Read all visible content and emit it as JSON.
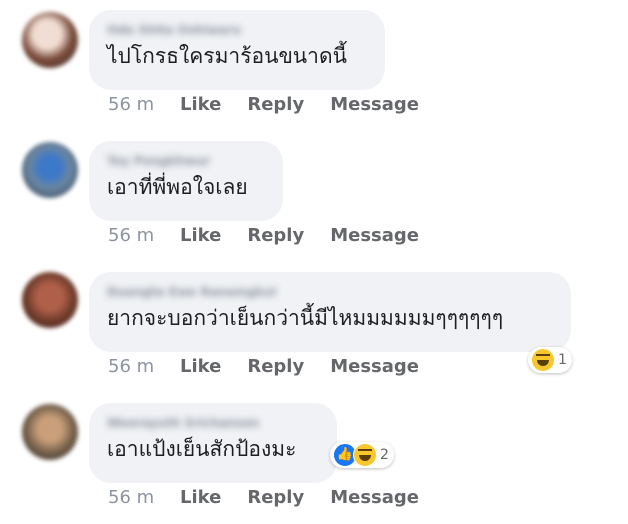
{
  "comments": [
    {
      "author": "Oda Shita Oshiwaru",
      "text": "ไปโกรธใครมาร้อนขนาดนี้",
      "time": "56 m",
      "like": "Like",
      "reply": "Reply",
      "message": "Message",
      "avatar_color": "#c9a89b"
    },
    {
      "author": "Toy Pongkhwur",
      "text": "เอาที่พี่พอใจเลย",
      "time": "56 m",
      "like": "Like",
      "reply": "Reply",
      "message": "Message",
      "avatar_color": "#5a6f86"
    },
    {
      "author": "Duangta Ewe Ranamgkul",
      "text": "ยากจะบอกว่าเย็นกว่านี้มีไหมมมมมมๆๆๆๆๆๆ",
      "time": "56 m",
      "like": "Like",
      "reply": "Reply",
      "message": "Message",
      "reaction_count": "1",
      "reaction_icons": [
        "haha-emoji"
      ],
      "avatar_color": "#8a4b3a"
    },
    {
      "author": "Weerayuth Srichansen",
      "text": "เอาแป้งเย็นสักป้องมะ",
      "time": "56 m",
      "like": "Like",
      "reply": "Reply",
      "message": "Message",
      "reaction_count": "2",
      "reaction_icons": [
        "like-emoji",
        "haha-emoji"
      ],
      "avatar_color": "#7c6a58"
    }
  ],
  "colors": {
    "bubble": "#f0f2f5",
    "text": "#1c1e21",
    "meta": "#8d949e",
    "action": "#65676b",
    "like_blue": "#1877f2",
    "haha_yellow": "#f7c72e"
  }
}
